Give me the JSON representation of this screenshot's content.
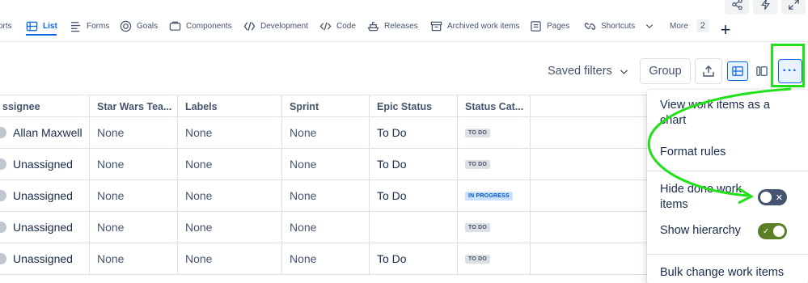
{
  "tabs": [
    {
      "label": "orts",
      "icon": "none"
    },
    {
      "label": "List",
      "icon": "list-icon",
      "active": true
    },
    {
      "label": "Forms",
      "icon": "forms-icon"
    },
    {
      "label": "Goals",
      "icon": "goals-icon"
    },
    {
      "label": "Components",
      "icon": "components-icon"
    },
    {
      "label": "Development",
      "icon": "code-brackets-icon"
    },
    {
      "label": "Code",
      "icon": "code-icon"
    },
    {
      "label": "Releases",
      "icon": "ship-icon"
    },
    {
      "label": "Archived work items",
      "icon": "archive-icon"
    },
    {
      "label": "Pages",
      "icon": "pages-icon"
    },
    {
      "label": "Shortcuts",
      "icon": "link-icon"
    },
    {
      "label": "More",
      "icon": "none"
    }
  ],
  "more_count": "2",
  "add_tab_label": "+",
  "toolbar": {
    "saved_filters": "Saved filters",
    "group": "Group",
    "more_label": "···"
  },
  "table": {
    "columns": [
      "ssignee",
      "Star Wars Tea...",
      "Labels",
      "Sprint",
      "Epic Status",
      "Status Cat..."
    ],
    "rows": [
      {
        "assignee": "Allan Maxwell",
        "team": "None",
        "labels": "None",
        "sprint": "None",
        "epic_status": "To Do",
        "status_cat": "TO DO"
      },
      {
        "assignee": "Unassigned",
        "team": "None",
        "labels": "None",
        "sprint": "None",
        "epic_status": "To Do",
        "status_cat": "TO DO"
      },
      {
        "assignee": "Unassigned",
        "team": "None",
        "labels": "None",
        "sprint": "None",
        "epic_status": "To Do",
        "status_cat": "IN PROGRESS"
      },
      {
        "assignee": "Unassigned",
        "team": "None",
        "labels": "None",
        "sprint": "None",
        "epic_status": "",
        "status_cat": "TO DO"
      },
      {
        "assignee": "Unassigned",
        "team": "None",
        "labels": "None",
        "sprint": "None",
        "epic_status": "To Do",
        "status_cat": "TO DO"
      }
    ]
  },
  "menu": {
    "view_as_chart": "View work items as a chart",
    "format_rules": "Format rules",
    "hide_done": "Hide done work items",
    "hide_done_on": false,
    "show_hierarchy": "Show hierarchy",
    "show_hierarchy_on": true,
    "bulk_change": "Bulk change work items"
  },
  "colors": {
    "accent": "#0c66e4",
    "highlight": "#22e01a",
    "toggle_on": "#5b7f24",
    "toggle_off": "#44546f"
  }
}
